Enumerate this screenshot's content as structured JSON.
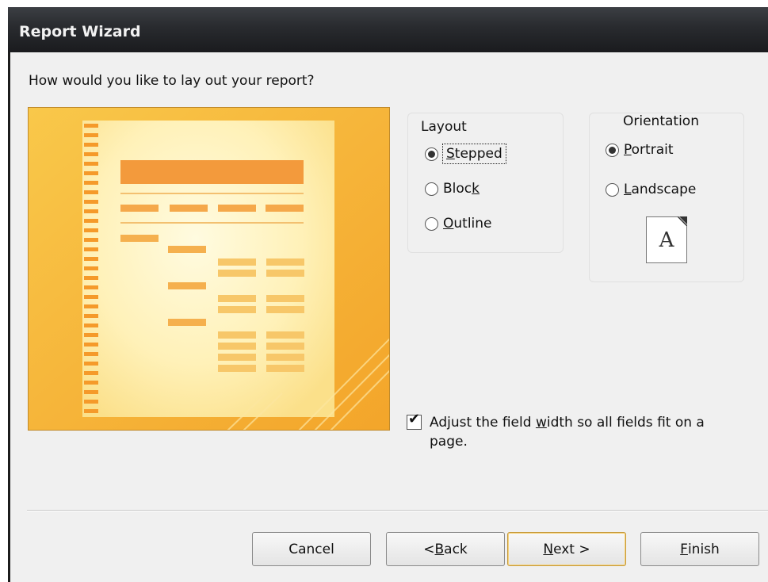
{
  "window": {
    "title": "Report Wizard"
  },
  "prompt": "How would you like to lay out your report?",
  "layout": {
    "title": "Layout",
    "options": [
      {
        "pre": "",
        "accel": "S",
        "post": "tepped",
        "selected": true
      },
      {
        "pre": "Bloc",
        "accel": "k",
        "post": "",
        "selected": false
      },
      {
        "pre": "",
        "accel": "O",
        "post": "utline",
        "selected": false
      }
    ]
  },
  "orientation": {
    "title": "Orientation",
    "options": [
      {
        "pre": "",
        "accel": "P",
        "post": "ortrait",
        "selected": true
      },
      {
        "pre": "",
        "accel": "L",
        "post": "andscape",
        "selected": false
      }
    ],
    "icon_letter": "A"
  },
  "adjust": {
    "checked": true,
    "pre": "Adjust the field ",
    "accel": "w",
    "post": "idth so all fields fit on a page."
  },
  "buttons": {
    "cancel": {
      "pre": "Cancel",
      "accel": "",
      "post": ""
    },
    "back": {
      "pre": "< ",
      "accel": "B",
      "post": "ack"
    },
    "next": {
      "pre": "",
      "accel": "N",
      "post": "ext >"
    },
    "finish": {
      "pre": "",
      "accel": "F",
      "post": "inish"
    }
  },
  "colors": {
    "preview_orange": "#f5a623",
    "preview_paper": "#fff4c4",
    "title_bar": "#2a2c30"
  }
}
